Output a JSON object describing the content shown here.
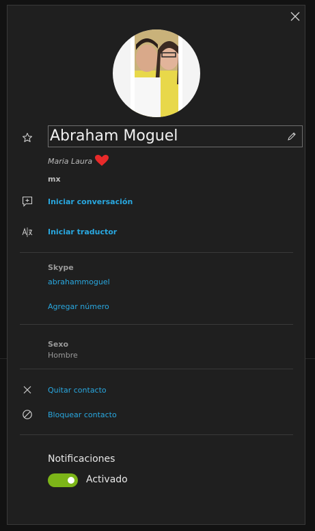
{
  "profile": {
    "name": "Abraham Moguel",
    "mood": "Maria Laura",
    "location": "mx"
  },
  "actions": {
    "start_conversation": "Iniciar conversación",
    "start_translator": "Iniciar traductor"
  },
  "skype": {
    "label": "Skype",
    "username": "abrahammoguel",
    "add_number": "Agregar número"
  },
  "gender": {
    "label": "Sexo",
    "value": "Hombre"
  },
  "contact_actions": {
    "remove": "Quitar contacto",
    "block": "Bloquear contacto"
  },
  "notifications": {
    "title": "Notificaciones",
    "toggle_label": "Activado",
    "enabled": true
  },
  "colors": {
    "accent_link": "#29a8e0",
    "toggle_on": "#7cb518",
    "heart": "#e82a2a",
    "panel_bg": "#1f1f1f"
  },
  "icons": [
    "close-icon",
    "star-icon",
    "pencil-icon",
    "heart-icon",
    "add-chat-icon",
    "translate-icon",
    "remove-icon",
    "block-icon"
  ]
}
